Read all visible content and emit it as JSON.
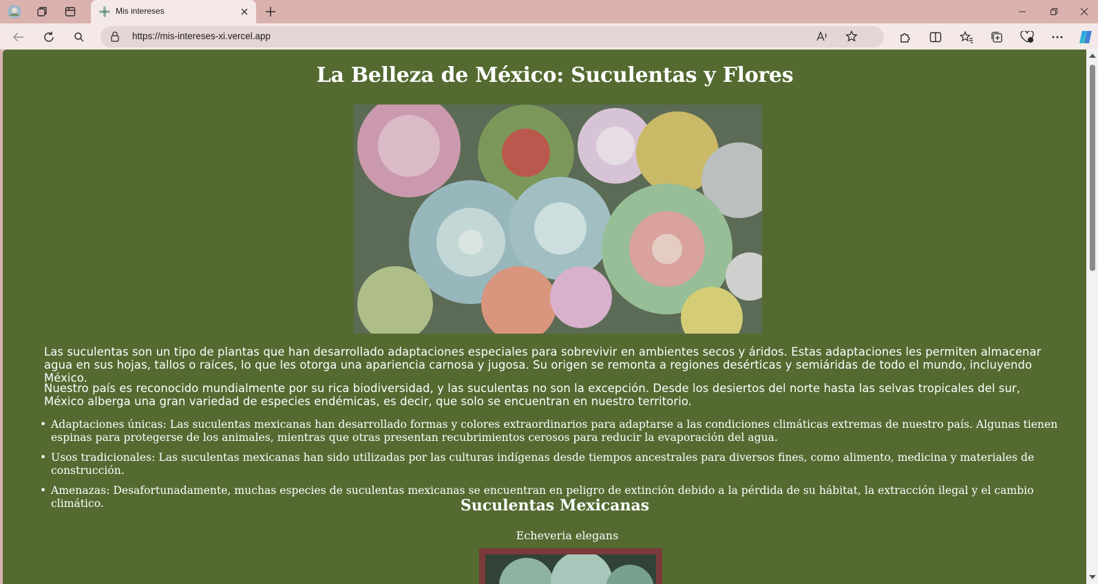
{
  "browser": {
    "tab_title": "Mis intereses",
    "url": "https://mis-intereses-xi.vercel.app",
    "icons": [
      "profile-icon",
      "workspaces-icon",
      "tab-actions-icon",
      "site-favicon",
      "close-tab-icon",
      "new-tab-icon",
      "minimize-icon",
      "restore-icon",
      "close-window-icon",
      "back-icon",
      "refresh-icon",
      "search-icon",
      "lock-icon",
      "read-aloud-icon",
      "favorite-star-icon",
      "extensions-icon",
      "split-screen-icon",
      "favorites-icon",
      "collections-icon",
      "browser-essentials-icon",
      "more-options-icon",
      "copilot-icon"
    ]
  },
  "page": {
    "title": "La Belleza de México: Suculentas y Flores",
    "paragraph_1": "Las suculentas son un tipo de plantas que han desarrollado adaptaciones especiales para sobrevivir en ambientes secos y áridos. Estas adaptaciones les permiten almacenar agua en sus hojas, tallos o raíces, lo que les otorga una apariencia carnosa y jugosa. Su origen se remonta a regiones desérticas y semiáridas de todo el mundo, incluyendo México.",
    "paragraph_2": "Nuestro país es reconocido mundialmente por su rica biodiversidad, y las suculentas no son la excepción. Desde los desiertos del norte hasta las selvas tropicales del sur, México alberga una gran variedad de especies endémicas, es decir, que solo se encuentran en nuestro territorio.",
    "list": [
      "Adaptaciones únicas: Las suculentas mexicanas han desarrollado formas y colores extraordinarios para adaptarse a las condiciones climáticas extremas de nuestro país. Algunas tienen espinas para protegerse de los animales, mientras que otras presentan recubrimientos cerosos para reducir la evaporación del agua.",
      "Usos tradicionales: Las suculentas mexicanas han sido utilizadas por las culturas indígenas desde tiempos ancestrales para diversos fines, como alimento, medicina y materiales de construcción.",
      "Amenazas: Desafortunadamente, muchas especies de suculentas mexicanas se encuentran en peligro de extinción debido a la pérdida de su hábitat, la extracción ilegal y el cambio climático."
    ],
    "section_title": "Suculentas Mexicanas",
    "card_caption": "Echeveria elegans"
  },
  "colors": {
    "page_background": "#546a31",
    "tabbar": "#dbb1ae",
    "toolbar": "#f4e9e8",
    "card_frame": "#7a3a3a"
  }
}
